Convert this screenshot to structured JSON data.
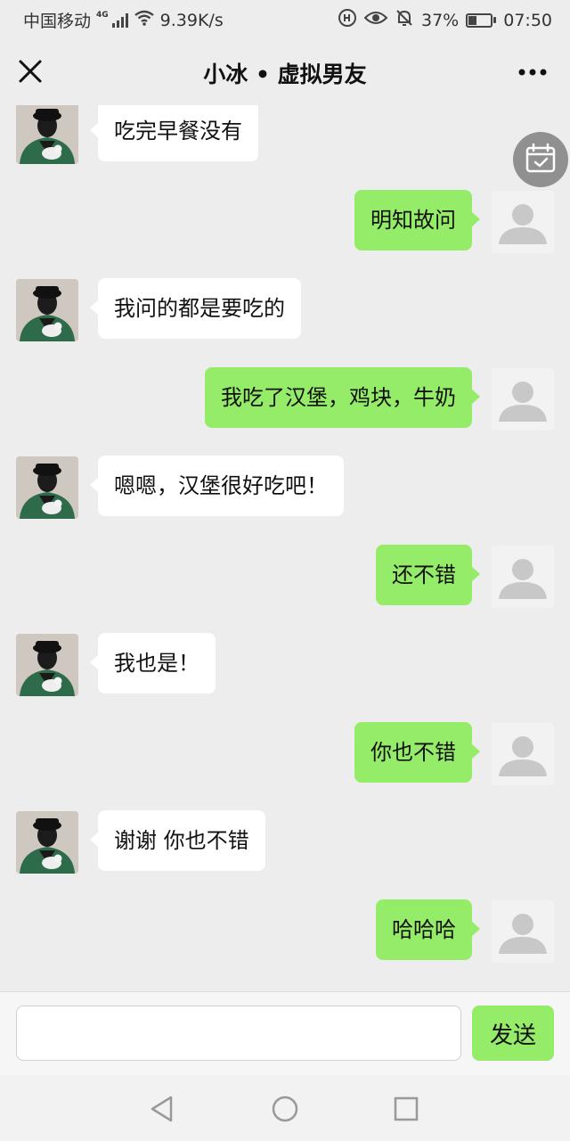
{
  "status_bar": {
    "carrier": "中国移动",
    "network": "4G",
    "speed": "9.39K/s",
    "battery": "37%",
    "battery_level": 0.37,
    "time": "07:50",
    "icons": [
      "signal-icon",
      "wifi-icon",
      "data-saver-icon",
      "eye-icon",
      "mute-bell-icon",
      "battery-icon"
    ]
  },
  "header": {
    "title": "小冰 • 虚拟男友",
    "left_icon": "close-icon",
    "right_icon": "more-icon"
  },
  "floating": {
    "icon": "calendar-check-icon"
  },
  "messages": [
    {
      "from": "xiaobing",
      "text": "吃完早餐没有"
    },
    {
      "from": "me",
      "text": "明知故问"
    },
    {
      "from": "xiaobing",
      "text": "我问的都是要吃的"
    },
    {
      "from": "me",
      "text": "我吃了汉堡，鸡块，牛奶"
    },
    {
      "from": "xiaobing",
      "text": "嗯嗯，汉堡很好吃吧！"
    },
    {
      "from": "me",
      "text": "还不错"
    },
    {
      "from": "xiaobing",
      "text": "我也是！"
    },
    {
      "from": "me",
      "text": "你也不错"
    },
    {
      "from": "xiaobing",
      "text": "谢谢 你也不错"
    },
    {
      "from": "me",
      "text": "哈哈哈"
    }
  ],
  "composer": {
    "value": "",
    "placeholder": "",
    "send_label": "发送"
  },
  "nav": {
    "icons": [
      "back-icon",
      "home-icon",
      "recents-icon"
    ]
  },
  "colors": {
    "background": "#ededed",
    "outgoing_bubble": "#95ec69",
    "incoming_bubble": "#ffffff"
  }
}
